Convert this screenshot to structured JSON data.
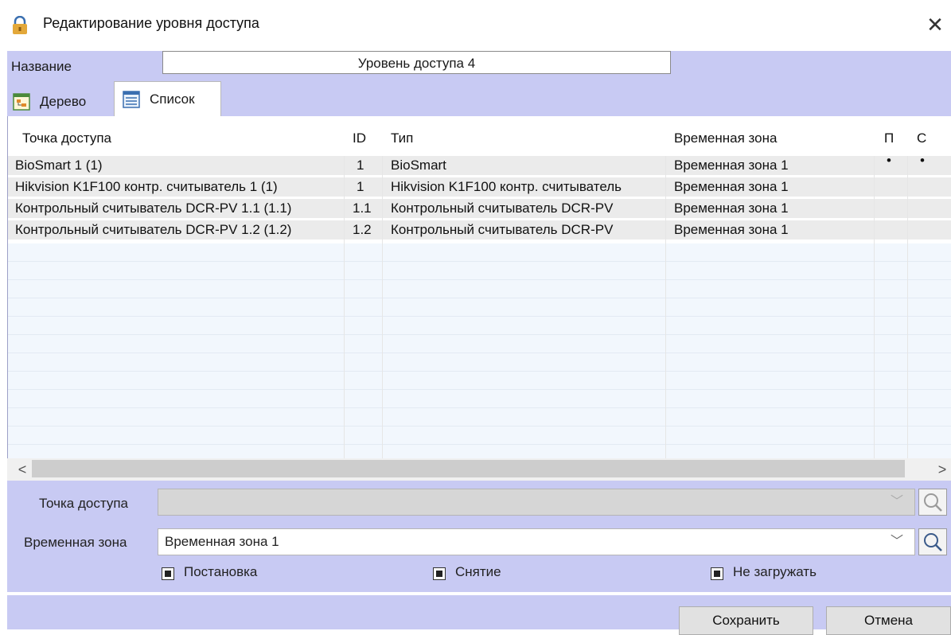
{
  "window": {
    "title": "Редактирование уровня доступа",
    "close_symbol": "✕"
  },
  "name_field": {
    "label": "Название",
    "value": "Уровень доступа 4"
  },
  "tabs": [
    {
      "label": "Дерево",
      "icon": "tree-icon",
      "active": false
    },
    {
      "label": "Список",
      "icon": "list-icon",
      "active": true
    }
  ],
  "grid": {
    "columns": [
      "Точка доступа",
      "ID",
      "Тип",
      "Временная зона",
      "П",
      "С"
    ],
    "rows": [
      {
        "point": "BioSmart 1 (1)",
        "id": "1",
        "type": "BioSmart",
        "zone": "Временная зона 1",
        "p": "•",
        "c": "•"
      },
      {
        "point": "Hikvision K1F100 контр. считыватель 1 (1)",
        "id": "1",
        "type": "Hikvision K1F100 контр. считыватель",
        "zone": "Временная зона 1",
        "p": "",
        "c": ""
      },
      {
        "point": "Контрольный считыватель DCR-PV 1.1 (1.1)",
        "id": "1.1",
        "type": "Контрольный считыватель DCR-PV",
        "zone": "Временная зона 1",
        "p": "",
        "c": ""
      },
      {
        "point": "Контрольный считыватель DCR-PV 1.2 (1.2)",
        "id": "1.2",
        "type": "Контрольный считыватель DCR-PV",
        "zone": "Временная зона 1",
        "p": "",
        "c": ""
      }
    ],
    "scroll_left": "<",
    "scroll_right": ">"
  },
  "form": {
    "access_point_label": "Точка доступа",
    "access_point_value": "",
    "time_zone_label": "Временная зона",
    "time_zone_value": "Временная зона 1",
    "checkboxes": [
      {
        "label": "Постановка",
        "checked": true
      },
      {
        "label": "Снятие",
        "checked": true
      },
      {
        "label": "Не загружать",
        "checked": true
      }
    ]
  },
  "buttons": {
    "save": "Сохранить",
    "cancel": "Отмена"
  },
  "colors": {
    "panel": "#c8caf3",
    "row_bg": "#ebebeb",
    "empty_row_bg": "#f2f7fd"
  }
}
